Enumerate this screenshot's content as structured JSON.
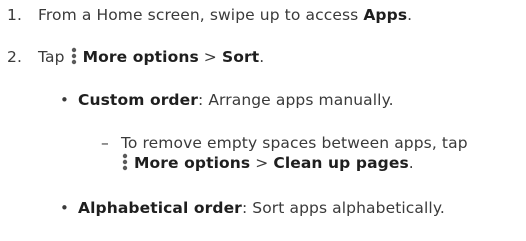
{
  "steps": [
    {
      "number": "1.",
      "text_before": "From a Home screen, swipe up to access ",
      "bold": "Apps",
      "text_after": "."
    },
    {
      "number": "2.",
      "text_before": "Tap ",
      "icon": "more-options-icon",
      "bold_1": "More options",
      "separator": " > ",
      "bold_2": "Sort",
      "text_after": "."
    }
  ],
  "sort_options": [
    {
      "bullet": "•",
      "term": "Custom order",
      "desc": ": Arrange apps manually."
    },
    {
      "bullet": "•",
      "term": "Alphabetical order",
      "desc": ": Sort apps alphabetically."
    }
  ],
  "sub_note": {
    "dash": "–",
    "line1": "To remove empty spaces between apps, tap",
    "icon": "more-options-icon",
    "bold_1": "More options",
    "separator": " > ",
    "bold_2": "Clean up pages",
    "text_after": "."
  },
  "colors": {
    "text": "#3a3a3a",
    "bold": "#1f1f1f",
    "icon": "#5a5a5a"
  }
}
